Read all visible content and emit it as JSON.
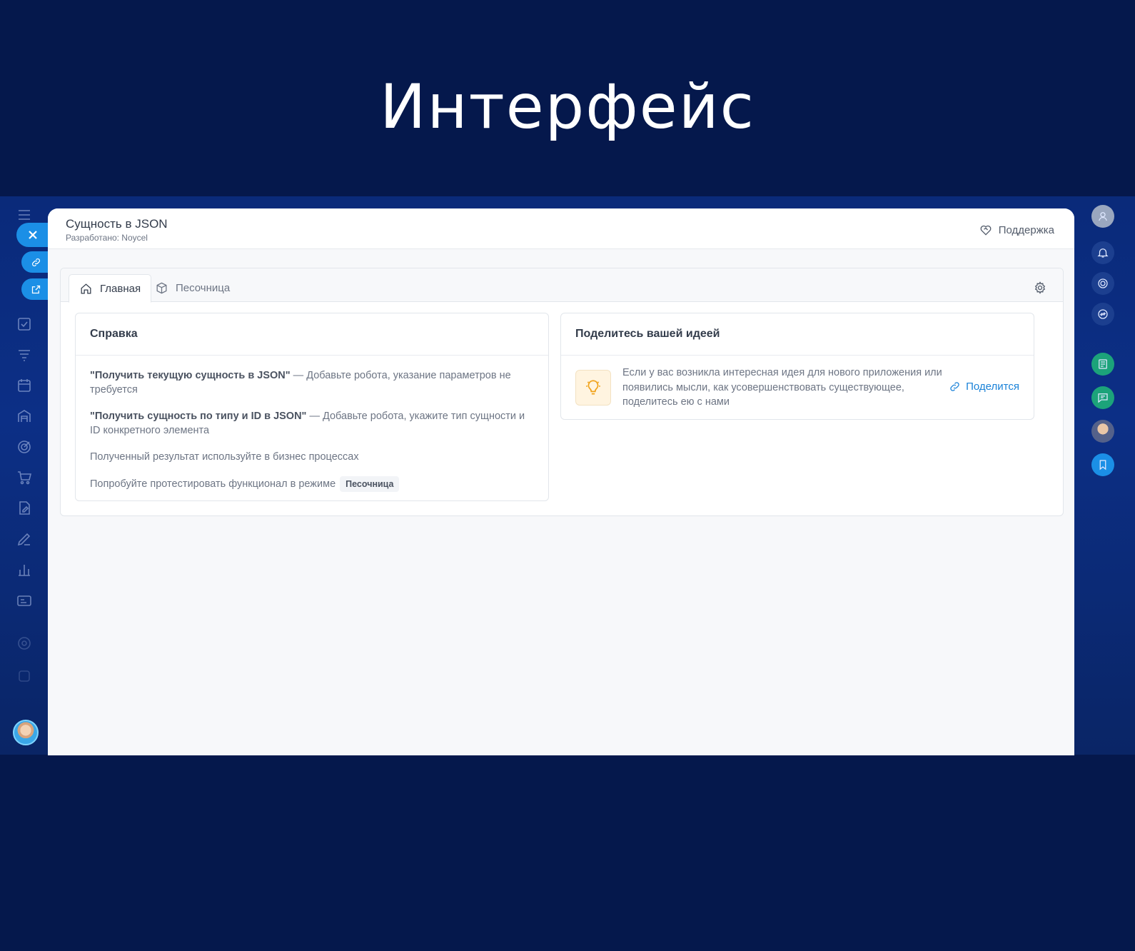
{
  "hero": {
    "title": "Интерфейс"
  },
  "app": {
    "title": "Сущность в JSON",
    "subtitle": "Разработано: Noycel",
    "support_label": "Поддержка"
  },
  "tabs": [
    {
      "label": "Главная",
      "active": true,
      "icon": "home-icon"
    },
    {
      "label": "Песочница",
      "active": false,
      "icon": "box-icon"
    }
  ],
  "help": {
    "title": "Справка",
    "items": [
      {
        "bold": "\"Получить текущую сущность в JSON\"",
        "text": " — Добавьте робота, указание параметров не требуется"
      },
      {
        "bold": "\"Получить сущность по типу и ID в JSON\"",
        "text": " — Добавьте робота, укажите тип сущности и ID конкретного элемента"
      },
      {
        "text": "Полученный результат используйте в бизнес процессах"
      },
      {
        "text": "Попробуйте протестировать функционал в режиме",
        "chip": "Песочница"
      }
    ]
  },
  "idea": {
    "title": "Поделитесь вашей идеей",
    "text": "Если у вас возникла интересная идея для нового приложения или появились мысли, как усовершенствовать существующее, поделитесь ею с нами",
    "share_label": "Поделится",
    "icon": "lightbulb-icon"
  },
  "colors": {
    "background": "#05184c",
    "accent": "#1b8fe6",
    "link": "#1a82d8",
    "idea_icon": "#f0a21a"
  }
}
